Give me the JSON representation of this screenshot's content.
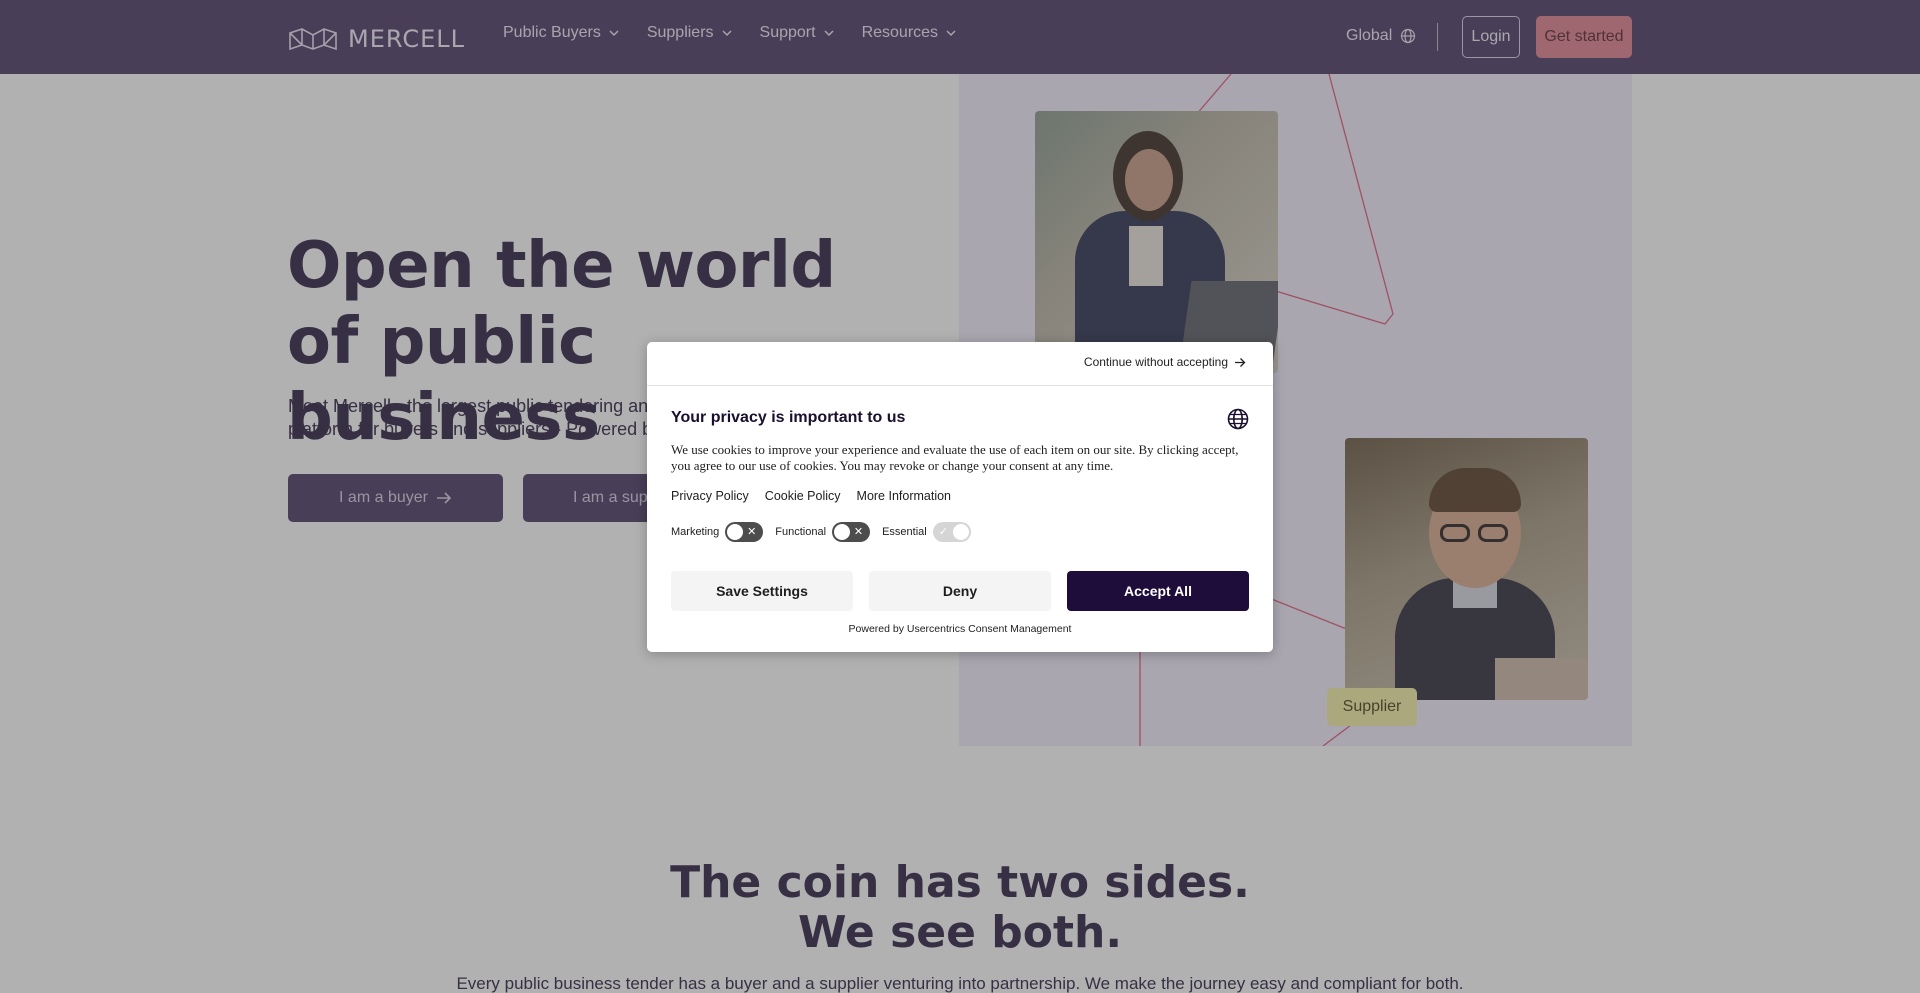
{
  "header": {
    "logo_text": "MERCELL",
    "nav": [
      {
        "label": "Public Buyers"
      },
      {
        "label": "Suppliers"
      },
      {
        "label": "Support"
      },
      {
        "label": "Resources"
      }
    ],
    "region_label": "Global",
    "login_label": "Login",
    "get_started_label": "Get started"
  },
  "hero": {
    "title": "Open the world of public business",
    "subtitle": "Meet Mercell - the largest public tendering and contracting platform for buyers and suppliers - Powered by AI.",
    "buyer_button": "I am a buyer",
    "supplier_button": "I am a supplier",
    "supplier_tag": "Supplier"
  },
  "section": {
    "title_line1": "The coin has two sides.",
    "title_line2": "We see both.",
    "text": "Every public business tender has a buyer and a supplier venturing into partnership. We make the journey easy and compliant for both."
  },
  "consent": {
    "continue_label": "Continue without accepting",
    "title": "Your privacy is important to us",
    "description": "We use cookies to improve your experience and evaluate the use of each item on our site. By clicking accept, you agree to our use of cookies. You may revoke or change your consent at any time.",
    "links": [
      "Privacy Policy",
      "Cookie Policy",
      "More Information"
    ],
    "toggles": [
      {
        "label": "Marketing",
        "enabled": false
      },
      {
        "label": "Functional",
        "enabled": false
      },
      {
        "label": "Essential",
        "enabled": true
      }
    ],
    "save_label": "Save Settings",
    "deny_label": "Deny",
    "accept_label": "Accept All",
    "powered_by": "Powered by Usercentrics Consent Management"
  },
  "colors": {
    "header_bg": "#4a3a64",
    "accent": "#e0828f",
    "dialog_accept": "#1e0c3a",
    "line_accent": "#e05a78"
  }
}
